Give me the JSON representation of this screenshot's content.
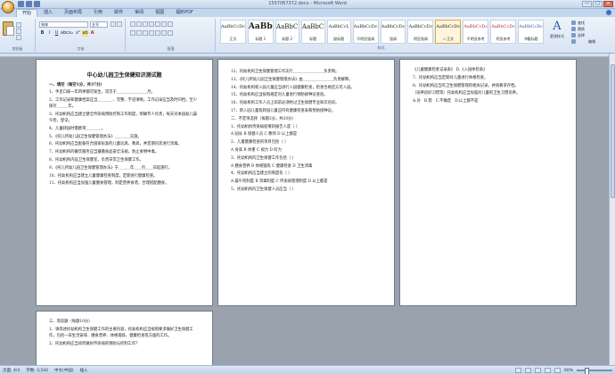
{
  "window": {
    "title": "1557067372.docx - Microsoft Word",
    "controls": [
      "—",
      "□",
      "×"
    ]
  },
  "tabs": [
    "开始",
    "插入",
    "页面布局",
    "引用",
    "邮件",
    "审阅",
    "视图",
    "福昕PDF"
  ],
  "ribbon": {
    "font_name": "宋体",
    "font_size": "五号",
    "styles": [
      {
        "sample": "AaBbCcDc",
        "name": "正文",
        "kind": "sm"
      },
      {
        "sample": "AaBb",
        "name": "标题 1",
        "kind": "h"
      },
      {
        "sample": "AaBbC",
        "name": "标题 2",
        "kind": ""
      },
      {
        "sample": "AaBbC",
        "name": "标题",
        "kind": ""
      },
      {
        "sample": "AaBbCcL",
        "name": "副标题",
        "kind": "sm"
      },
      {
        "sample": "AaBbCcDc",
        "name": "不明显强调",
        "kind": "sm"
      },
      {
        "sample": "AaBbCcDc",
        "name": "强调",
        "kind": "sm"
      },
      {
        "sample": "AaBbCcDc",
        "name": "明显强调",
        "kind": "sm"
      },
      {
        "sample": "AaBbCcDc",
        "name": "→ 正文",
        "kind": "sm sel"
      },
      {
        "sample": "AaBbCcDc",
        "name": "不明显参考",
        "kind": "sm red"
      },
      {
        "sample": "AaBbCcDc",
        "name": "明显参考",
        "kind": "sm red"
      },
      {
        "sample": "AaBbCcDc",
        "name": "书籍标题",
        "kind": "sm blue"
      }
    ],
    "groups": [
      "剪贴板",
      "字体",
      "段落",
      "样式",
      "编辑"
    ],
    "change_styles": "更改样式",
    "edit": [
      "查找",
      "替换",
      "选择"
    ]
  },
  "pages": [
    {
      "title": "中心幼儿园卫生保健知识测试题",
      "section": "一、填空（每空1分，共37分）",
      "lines": [
        "1、手足口病一年四季都可发生，常见于＿＿＿＿＿＿＿＿月。",
        "2、工作记录和健康档案应当＿＿＿＿、完整、字迹清晰。工作记录应当及时归档，至少保存＿＿＿年。",
        "3、托幼机构应当建立健全传染病预防控制工作制度，明确专人负责，每天对本园幼儿晨午检，登记。",
        "4、儿童转园时需携带＿＿＿＿。",
        "5、《托儿所幼儿园卫生保健管理办法》＿＿＿＿实施。",
        "6、托幼机构应当配备符合国家标准的儿童玩具、教具，并定期对其进行消毒。",
        "7、托幼机构的餐饮服务应当遵循食品安全法规，防止食物中毒。",
        "8、托幼机构内设卫生保健室，负责日常卫生保健工作。",
        "9、《托儿所幼儿园卫生保健管理办法》于＿＿＿年＿＿月＿＿日起施行。",
        "10、托幼机构应当建立儿童健康检查制度，定期进行健康检查。",
        "11、托幼机构应当加强儿童膳食管理，制定营养食谱，合理搭配膳食。"
      ]
    },
    {
      "lines": [
        "12、托幼机构卫生保健管理工作实行＿＿＿＿＿＿＿＿负责制。",
        "13、《托儿所幼儿园卫生保健管理办法》由＿＿＿＿＿＿＿＿负责解释。",
        "14、托幼机构新入园儿童应当进行入园健康检查，检查合格后方可入园。",
        "15、托幼机构应当按照规定对儿童进行预防接种证查验。",
        "16、托幼机构工作人员上岗前必须经过卫生保健专业知识培训。",
        "17、新入园儿童及转园儿童应持有健康检查表和预防接种证。",
        "二、不定项选择（每题2分，共20分）",
        "1、托幼机构传染病疫情的报告人是（ ）",
        "A 园长 B 保健人员 C 教师 D 以上都是",
        "2、儿童健康检查的项目包括（ ）",
        "A 身高 B 体重 C 视力 D 听力",
        "3、托幼机构的卫生保健工作包括（ ）",
        "A 膳食营养 B 体格锻炼 C 健康检查 D 卫生消毒",
        "4、托幼机构应当建立的制度有（ ）",
        "A 晨午检制度 B 消毒制度 C 传染病管理制度 D 以上都是",
        "5、托幼机构的卫生保健人员应当（ ）"
      ]
    },
    {
      "lines": [
        "《儿童健康检查记录表》 D.《入园体检表》",
        "7、托幼机构应当定期对儿童进行体格检查。",
        "8、托幼机构应当有卫生保健管理的相关记录，并按要求存档。",
        "（培养良好习惯等）托幼机构应当加强对儿童的卫生习惯培养。",
        "A.对   B.错   C.不确定   D.以上都不是",
        "",
        "",
        "",
        "",
        "",
        "",
        "",
        "",
        "",
        "",
        "",
        ""
      ]
    },
    {
      "lines": [
        "三、简答题（每题10分）",
        "1、请简述托幼机构卫生保健工作的主要内容，托幼机构应当按照要求做好卫生保健工作，包括一日生活安排、膳食营养、体格锻炼、健康检查等方面的工作。",
        "2、托幼机构应当如何做好传染病的预防与控制工作？"
      ]
    }
  ],
  "status": {
    "page": "页面: 4/4",
    "words": "字数: 3,544",
    "lang": "中文(中国)",
    "mode": "插入",
    "zoom": "60%"
  }
}
